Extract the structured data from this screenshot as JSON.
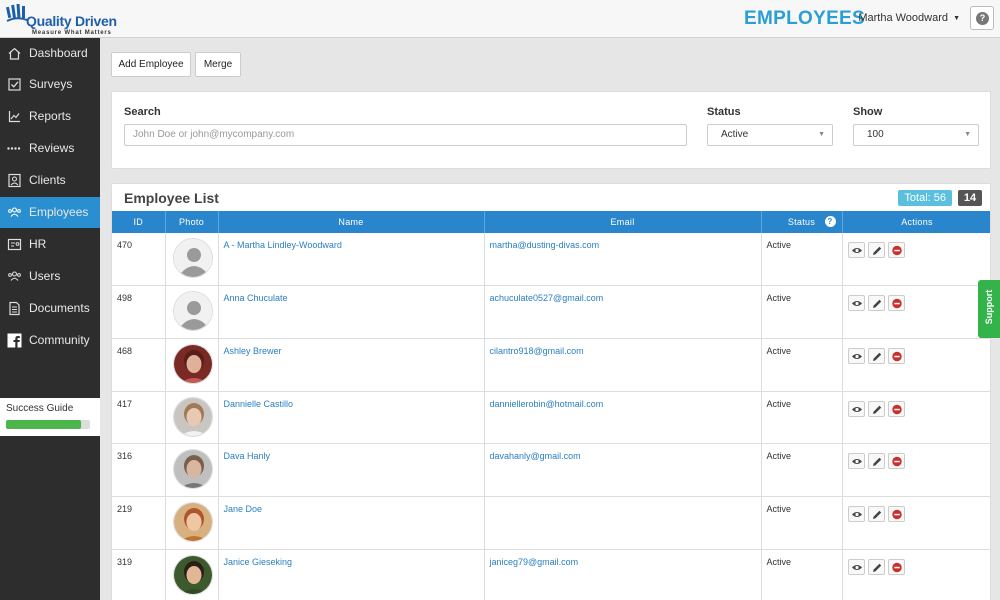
{
  "header": {
    "logo_text": "Quality Driven",
    "logo_tagline": "Measure What Matters",
    "page_title": "EMPLOYEES",
    "user_name": "Martha Woodward",
    "help_label": "?"
  },
  "sidebar": {
    "items": [
      {
        "label": "Dashboard",
        "icon": "home-icon"
      },
      {
        "label": "Surveys",
        "icon": "checkbox-icon"
      },
      {
        "label": "Reports",
        "icon": "chart-icon"
      },
      {
        "label": "Reviews",
        "icon": "dots-icon"
      },
      {
        "label": "Clients",
        "icon": "contact-card-icon"
      },
      {
        "label": "Employees",
        "icon": "people-icon"
      },
      {
        "label": "HR",
        "icon": "hr-card-icon"
      },
      {
        "label": "Users",
        "icon": "users-icon"
      },
      {
        "label": "Documents",
        "icon": "document-icon"
      },
      {
        "label": "Community",
        "icon": "facebook-icon"
      }
    ],
    "active_index": 5,
    "guide_label": "Success Guide",
    "guide_progress": 0.89
  },
  "toolbar": {
    "add_label": "Add Employee",
    "merge_label": "Merge"
  },
  "filters": {
    "search_label": "Search",
    "search_placeholder": "John Doe or john@mycompany.com",
    "status_label": "Status",
    "status_value": "Active",
    "show_label": "Show",
    "show_value": "100"
  },
  "list": {
    "title": "Employee List",
    "total_label": "Total: 56",
    "count": "14",
    "columns": [
      "ID",
      "Photo",
      "Name",
      "Email",
      "Status",
      "Actions"
    ],
    "rows": [
      {
        "id": "470",
        "name": "A - Martha Lindley-Woodward",
        "email": "martha@dusting-divas.com",
        "status": "Active",
        "photo": "placeholder"
      },
      {
        "id": "498",
        "name": "Anna Chuculate",
        "email": "achuculate0527@gmail.com",
        "status": "Active",
        "photo": "placeholder"
      },
      {
        "id": "468",
        "name": "Ashley Brewer",
        "email": "cilantro918@gmail.com",
        "status": "Active",
        "photo": "photo-1"
      },
      {
        "id": "417",
        "name": "Dannielle Castillo",
        "email": "danniellerobin@hotmail.com",
        "status": "Active",
        "photo": "photo-2"
      },
      {
        "id": "316",
        "name": "Dava Hanly",
        "email": "davahanly@gmail.com",
        "status": "Active",
        "photo": "photo-3"
      },
      {
        "id": "219",
        "name": "Jane Doe",
        "email": "",
        "status": "Active",
        "photo": "photo-4"
      },
      {
        "id": "319",
        "name": "Janice Gieseking",
        "email": "janiceg79@gmail.com",
        "status": "Active",
        "photo": "photo-5"
      }
    ]
  },
  "support_label": "Support",
  "colors": {
    "accent": "#2a86cc",
    "heading": "#2a9fd6",
    "sidebar_bg": "#2d2d2d",
    "active_nav": "#2a8fd1",
    "total_badge": "#5bc0de",
    "support": "#33b34a",
    "delete": "#c9302c"
  }
}
